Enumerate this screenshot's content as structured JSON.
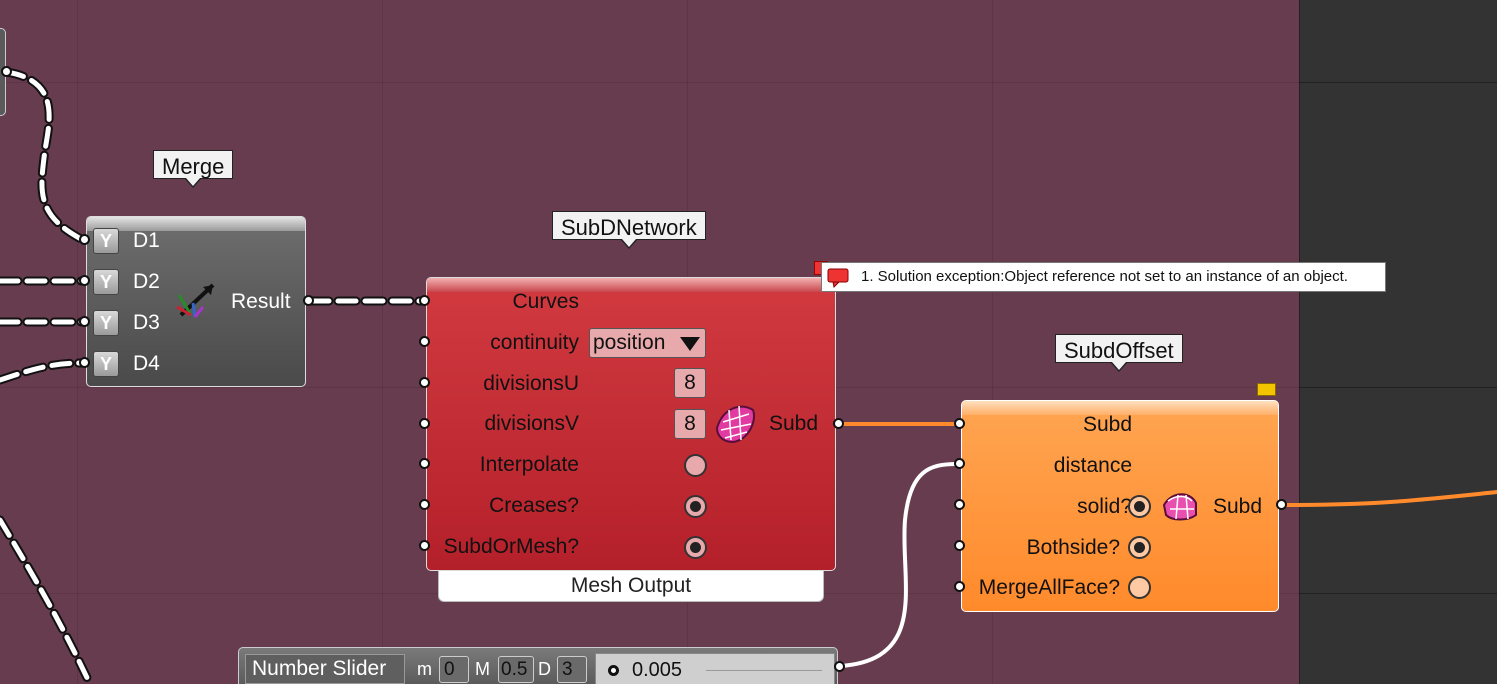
{
  "colors": {
    "canvas": "#683c4f",
    "wire": "#ffffff",
    "wire_selected": "#ff8a2b",
    "subdnetwork_fill": "#c5282f",
    "subdoffset_fill": "#ff9a46",
    "merge_fill": "#5a5a5a"
  },
  "merge": {
    "title": "Merge",
    "inputs": [
      "D1",
      "D2",
      "D3",
      "D4"
    ],
    "output": "Result",
    "icon": "merge-arrows-icon"
  },
  "subdnetwork": {
    "title": "SubDNetwork",
    "inputs": {
      "curves": "Curves",
      "continuity": "continuity",
      "divisionsU": "divisionsU",
      "divisionsV": "divisionsV",
      "interpolate": "Interpolate",
      "creases": "Creases?",
      "subdormesh": "SubdOrMesh?"
    },
    "continuity_value": "position",
    "divisionsU_value": "8",
    "divisionsV_value": "8",
    "output": "Subd",
    "footer": "Mesh Output",
    "icon": "subd-mesh-icon"
  },
  "error": {
    "text": "1. Solution exception:Object reference not set to an instance of an object.",
    "icon": "error-balloon-icon"
  },
  "subdoffset": {
    "title": "SubdOffset",
    "inputs": {
      "subd": "Subd",
      "distance": "distance",
      "solid": "solid?",
      "bothside": "Bothside?",
      "mergeallface": "MergeAllFace?"
    },
    "output": "Subd",
    "icon": "subd-offset-icon",
    "warning_icon": "warning-balloon-icon"
  },
  "slider": {
    "title": "Number Slider",
    "m_label": "m",
    "m_value": "0",
    "M_label": "M",
    "M_value": "0.5",
    "D_label": "D",
    "D_value": "3",
    "value": "0.005"
  }
}
